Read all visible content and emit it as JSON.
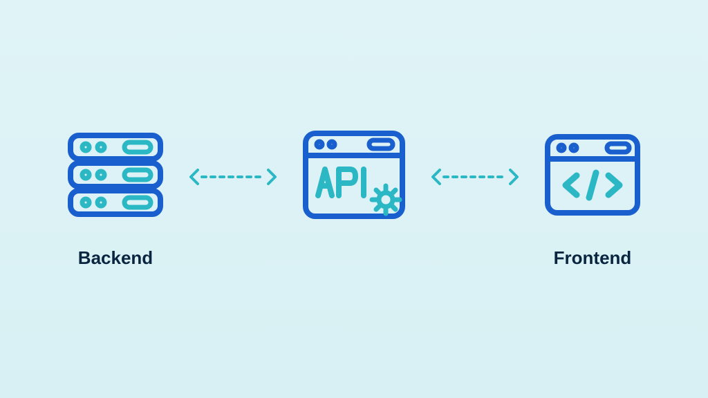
{
  "diagram": {
    "backend": {
      "label": "Backend",
      "icon": "server-stack-icon"
    },
    "api": {
      "label": "API",
      "icon": "api-window-icon"
    },
    "frontend": {
      "label": "Frontend",
      "icon": "code-window-icon"
    },
    "colors": {
      "primary": "#1a5fce",
      "accent": "#2bb8c4",
      "text": "#0a2540",
      "background": "#e0f4f7"
    }
  }
}
